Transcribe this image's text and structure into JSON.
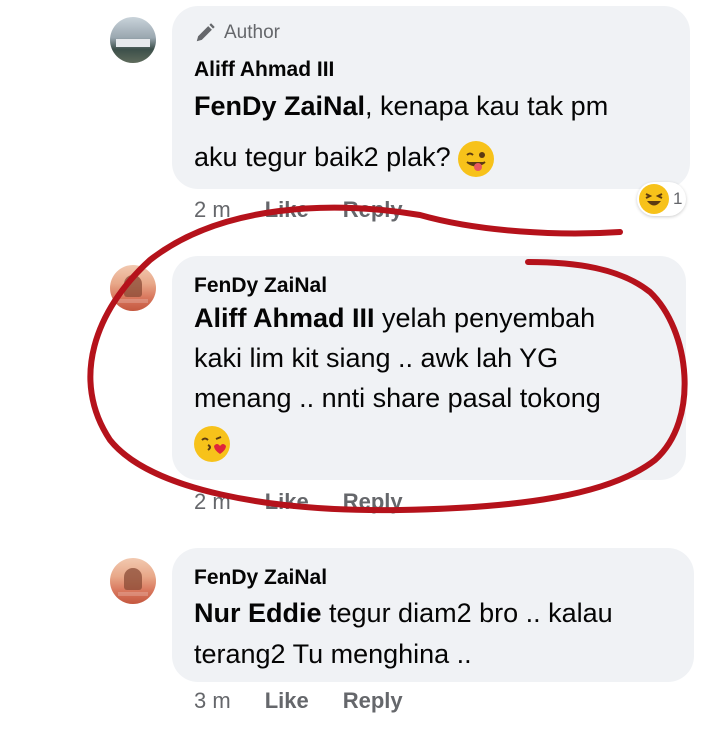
{
  "comments": [
    {
      "badge": "Author",
      "name": "Aliff Ahmad III",
      "mention": "FenDy ZaiNal",
      "text_line1": ", kenapa kau tak pm",
      "text_line2": "aku tegur baik2 plak?",
      "emoji": "winking-tongue-emoji",
      "time": "2 m",
      "like": "Like",
      "reply": "Reply",
      "reaction": {
        "emoji": "laughing-emoji",
        "count": "1"
      }
    },
    {
      "name": "FenDy ZaiNal",
      "mention": "Aliff Ahmad III",
      "text_line1": " yelah penyembah",
      "text_line2": "kaki lim kit siang .. awk lah YG",
      "text_line3": "menang .. nnti share pasal tokong",
      "emoji": "kissing-heart-emoji",
      "time": "2 m",
      "like": "Like",
      "reply": "Reply"
    },
    {
      "name": "FenDy ZaiNal",
      "mention": "Nur Eddie",
      "text_line1": " tegur diam2 bro .. kalau",
      "text_line2": "terang2 Tu menghina ..",
      "time": "3 m",
      "like": "Like",
      "reply": "Reply"
    }
  ],
  "colors": {
    "bubble": "#f0f2f5",
    "meta": "#65676b",
    "annotation": "#b5121b"
  }
}
